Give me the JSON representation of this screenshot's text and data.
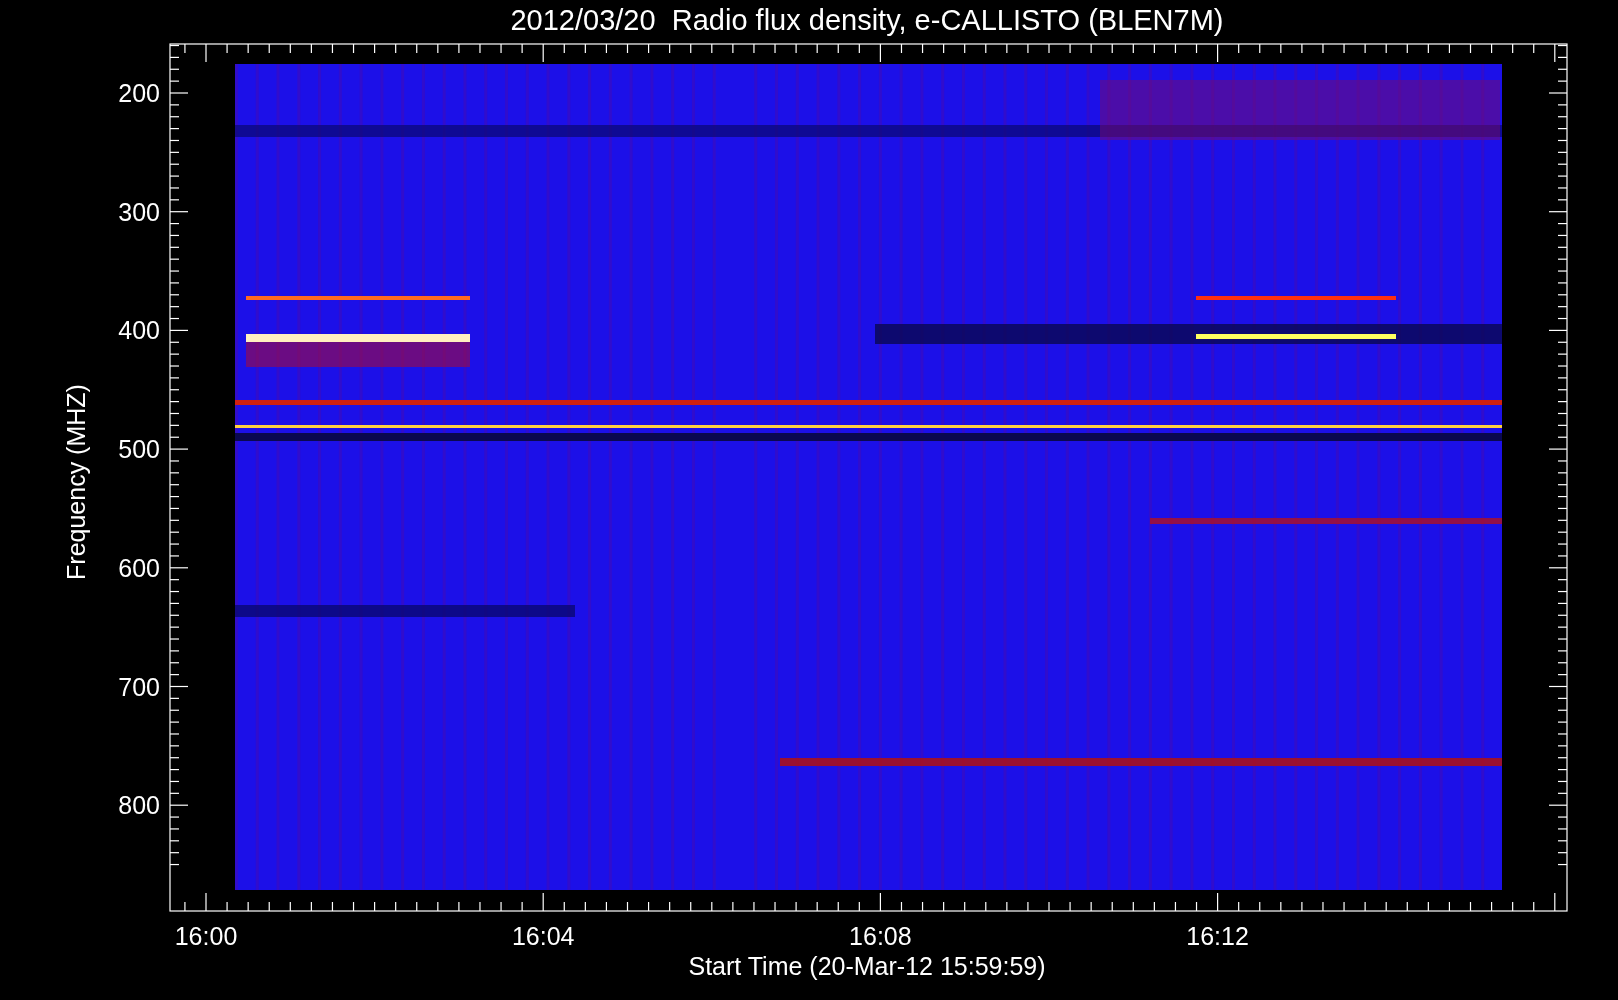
{
  "title": "2012/03/20  Radio flux density, e-CALLISTO (BLEN7M)",
  "y_axis": {
    "label": "Frequency (MHZ)",
    "ticks": [
      "200",
      "300",
      "400",
      "500",
      "600",
      "700",
      "800"
    ]
  },
  "x_axis": {
    "label": "Start Time (20-Mar-12 15:59:59)",
    "ticks": [
      "16:00",
      "16:04",
      "16:08",
      "16:12"
    ]
  }
}
